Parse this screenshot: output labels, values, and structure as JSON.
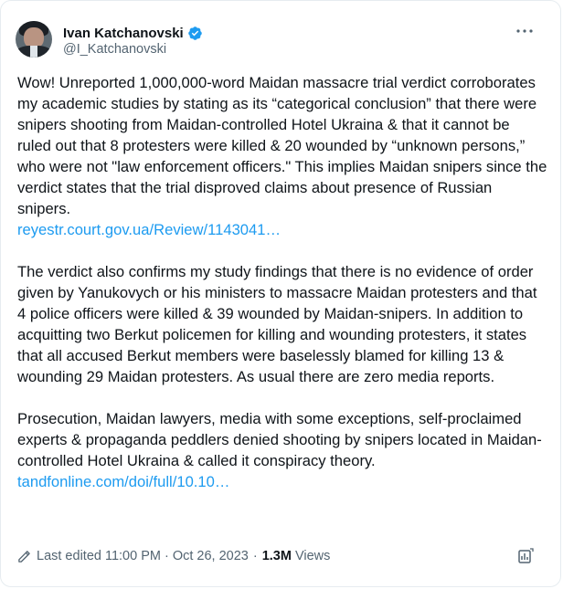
{
  "author": {
    "display_name": "Ivan Katchanovski",
    "handle": "@I_Katchanovski",
    "verified": true,
    "avatar_icon": "profile-photo"
  },
  "tweet": {
    "paragraph_1": "Wow! Unreported 1,000,000-word Maidan massacre trial verdict corroborates my academic studies by stating as its “categorical conclusion” that there were snipers shooting from Maidan-controlled Hotel Ukraina & that it cannot be ruled out that 8 protesters were killed & 20 wounded by “unknown persons,” who were not \"law enforcement officers.\" This implies Maidan snipers since the verdict states that the trial disproved claims about presence of Russian snipers.",
    "link_1": "reyestr.court.gov.ua/Review/1143041…",
    "paragraph_2": "The verdict also confirms my study findings that there is no evidence of order given by Yanukovych or his ministers to massacre Maidan protesters and that 4 police officers were killed & 39 wounded by Maidan-snipers. In addition to acquitting two Berkut policemen for killing and wounding protesters, it states that all accused Berkut members were baselessly blamed for killing 13 & wounding 29 Maidan protesters. As usual there are zero media reports.",
    "paragraph_3": "Prosecution, Maidan lawyers, media with some exceptions, self-proclaimed experts & propaganda peddlers denied shooting by snipers located in Maidan-controlled Hotel Ukraina & called it conspiracy theory.",
    "link_2": "tandfonline.com/doi/full/10.10…"
  },
  "meta": {
    "edited_label": "Last edited 11:00 PM · Oct 26, 2023",
    "separator": "·",
    "views_count": "1.3M",
    "views_label": "Views"
  },
  "colors": {
    "text": "#0f1419",
    "secondary": "#536471",
    "link": "#1d9bf0",
    "verified": "#1d9bf0"
  }
}
